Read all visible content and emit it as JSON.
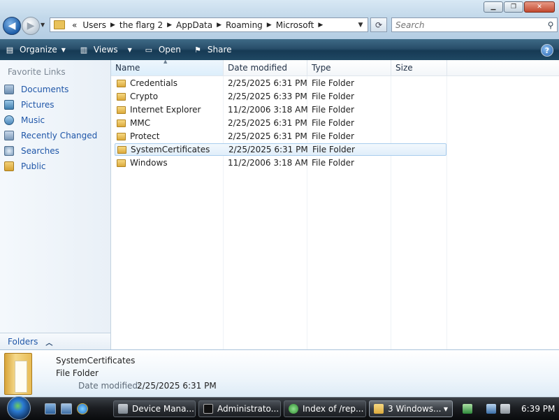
{
  "window": {
    "minimize_glyph": "▁",
    "maximize_glyph": "❐",
    "close_glyph": "✕"
  },
  "address": {
    "overflow": "«",
    "crumbs": [
      "Users",
      "the flarg 2",
      "AppData",
      "Roaming",
      "Microsoft"
    ],
    "search_placeholder": "Search"
  },
  "toolbar": {
    "organize": "Organize",
    "views": "Views",
    "open": "Open",
    "share": "Share"
  },
  "nav": {
    "header": "Favorite Links",
    "links": [
      "Documents",
      "Pictures",
      "Music",
      "Recently Changed",
      "Searches",
      "Public"
    ],
    "folders_label": "Folders"
  },
  "columns": {
    "name": "Name",
    "date_modified": "Date modified",
    "type": "Type",
    "size": "Size"
  },
  "files": [
    {
      "name": "Credentials",
      "date": "2/25/2025 6:31 PM",
      "type": "File Folder"
    },
    {
      "name": "Crypto",
      "date": "2/25/2025 6:33 PM",
      "type": "File Folder"
    },
    {
      "name": "Internet Explorer",
      "date": "11/2/2006 3:18 AM",
      "type": "File Folder"
    },
    {
      "name": "MMC",
      "date": "2/25/2025 6:31 PM",
      "type": "File Folder"
    },
    {
      "name": "Protect",
      "date": "2/25/2025 6:31 PM",
      "type": "File Folder"
    },
    {
      "name": "SystemCertificates",
      "date": "2/25/2025 6:31 PM",
      "type": "File Folder",
      "selected": true
    },
    {
      "name": "Windows",
      "date": "11/2/2006 3:18 AM",
      "type": "File Folder"
    }
  ],
  "details": {
    "name": "SystemCertificates",
    "type": "File Folder",
    "date_label": "Date modified:",
    "date_value": "2/25/2025 6:31 PM"
  },
  "taskbar": {
    "tasks": [
      "Device Mana...",
      "Administrato...",
      "Index of /rep...",
      "3 Windows..."
    ],
    "clock": "6:39 PM"
  },
  "icons": {
    "back": "back-arrow-icon",
    "forward": "forward-arrow-icon",
    "refresh": "refresh-icon",
    "search": "search-icon",
    "help": "help-icon"
  }
}
